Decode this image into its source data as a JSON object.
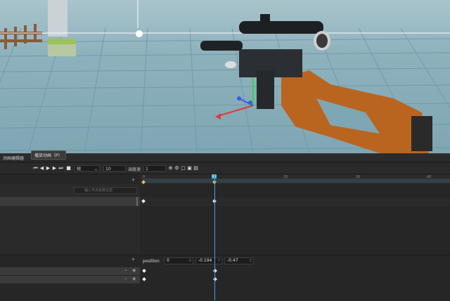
{
  "editor": {
    "tab_title": "动画编辑器",
    "tooltip": "播放动画（P）",
    "toolbar": {
      "mode_value": "帧",
      "sample_value": "10",
      "speed_label": "调度速",
      "speed_value": "1"
    },
    "ruler_ticks": [
      "0",
      "10",
      "20",
      "30",
      "40"
    ],
    "current_frame": "10",
    "search_placeholder": "输入节点名称过滤",
    "property": {
      "name": "position",
      "x": "0",
      "y": "-0.194",
      "z": "-0.47"
    }
  },
  "colors": {
    "accent": "#3aa8d8",
    "panel": "#262626",
    "keyframe": "#eeeeee"
  }
}
